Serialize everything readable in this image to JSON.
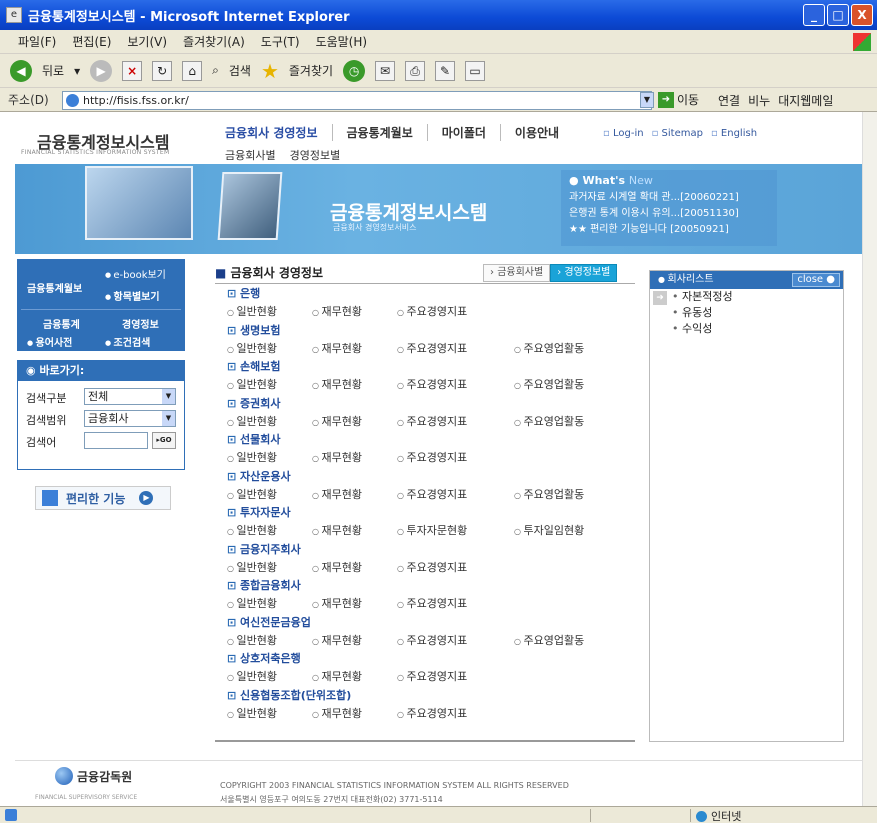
{
  "window": {
    "title": "금융통계정보시스템 - Microsoft Internet Explorer",
    "btn_min": "_",
    "btn_max": "□",
    "btn_close": "X"
  },
  "menu": [
    "파일(F)",
    "편집(E)",
    "보기(V)",
    "즐겨찾기(A)",
    "도구(T)",
    "도움말(H)"
  ],
  "toolbar": {
    "back": "뒤로",
    "search": "검색",
    "favorites": "즐겨찾기"
  },
  "address": {
    "label": "주소(D)",
    "url": "http://fisis.fss.or.kr/",
    "go": "이동",
    "links": [
      "연결",
      "비누",
      "대지웹메일"
    ]
  },
  "site": {
    "logo_title": "금융통계정보시스템",
    "logo_sub": "FINANCIAL STATISTICS INFORMATION SYSTEM",
    "gnb": [
      "금융회사 경영정보",
      "금융통계월보",
      "마이폴더",
      "이용안내"
    ],
    "util": [
      "Log-in",
      "Sitemap",
      "English"
    ],
    "subnav": [
      "금융회사별",
      "경영정보별"
    ]
  },
  "banner": {
    "title": "금융통계정보시스템",
    "subtitle": "금융회사 경영정보서비스",
    "whatsnew_title": "What's",
    "whatsnew_new": "New",
    "whatsnew_items": [
      "과거자료 시계열 확대 관...[20060221]",
      "은행권 통계 이용시 유의...[20051130]",
      "★★ 편리한 기능입니다   [20050921]"
    ]
  },
  "left": {
    "quick": {
      "monthly": "금융통계월보",
      "ebook": "e-book보기",
      "byitem": "항목별보기",
      "stat": "금융통계",
      "mgmt": "경영정보",
      "glossary": "용어사전",
      "search": "조건검색"
    },
    "goto": {
      "title": "바로가기:",
      "type_label": "검색구분",
      "type_value": "전체",
      "range_label": "검색범위",
      "range_value": "금융회사",
      "keyword_label": "검색어",
      "go": "▸GO"
    },
    "feature_label": "편리한 기능"
  },
  "main": {
    "title": "금융회사 경영정보",
    "tabs": [
      "금융회사별",
      "경영정보별"
    ],
    "categories": [
      {
        "name": "은행",
        "items": [
          "일반현황",
          "재무현황",
          "주요경영지표"
        ]
      },
      {
        "name": "생명보험",
        "items": [
          "일반현황",
          "재무현황",
          "주요경영지표",
          "주요영업활동"
        ]
      },
      {
        "name": "손해보험",
        "items": [
          "일반현황",
          "재무현황",
          "주요경영지표",
          "주요영업활동"
        ]
      },
      {
        "name": "증권회사",
        "items": [
          "일반현황",
          "재무현황",
          "주요경영지표",
          "주요영업활동"
        ]
      },
      {
        "name": "선물회사",
        "items": [
          "일반현황",
          "재무현황",
          "주요경영지표"
        ]
      },
      {
        "name": "자산운용사",
        "items": [
          "일반현황",
          "재무현황",
          "주요경영지표",
          "주요영업활동"
        ]
      },
      {
        "name": "투자자문사",
        "items": [
          "일반현황",
          "재무현황",
          "투자자문현황",
          "투자일임현황"
        ]
      },
      {
        "name": "금융지주회사",
        "items": [
          "일반현황",
          "재무현황",
          "주요경영지표"
        ]
      },
      {
        "name": "종합금융회사",
        "items": [
          "일반현황",
          "재무현황",
          "주요경영지표"
        ]
      },
      {
        "name": "여신전문금융업",
        "items": [
          "일반현황",
          "재무현황",
          "주요경영지표",
          "주요영업활동"
        ]
      },
      {
        "name": "상호저축은행",
        "items": [
          "일반현황",
          "재무현황",
          "주요경영지표"
        ]
      },
      {
        "name": "신용협동조합(단위조합)",
        "items": [
          "일반현황",
          "재무현황",
          "주요경영지표"
        ]
      }
    ]
  },
  "right": {
    "title": "회사리스트",
    "close": "close",
    "items": [
      "자본적정성",
      "유동성",
      "수익성"
    ]
  },
  "footer": {
    "logo": "금융감독원",
    "logo_sub": "FINANCIAL SUPERVISORY SERVICE",
    "copyright": "COPYRIGHT 2003 FINANCIAL STATISTICS INFORMATION SYSTEM ALL RIGHTS RESERVED",
    "address": "서울특별시 영등포구 여의도동 27번지 대표전화(02) 3771-5114"
  },
  "status": {
    "zone": "인터넷"
  }
}
